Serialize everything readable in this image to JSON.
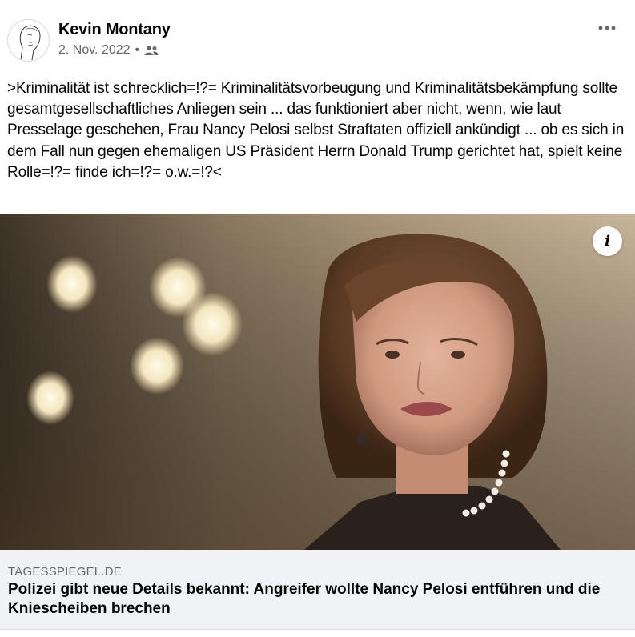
{
  "post": {
    "author": "Kevin Montany",
    "date": "2. Nov. 2022",
    "separator": "•",
    "audience_icon": "friends-icon",
    "more_icon": "more-options-icon",
    "text": ">Kriminalität ist schrecklich=!?= Kriminalitätsvorbeugung und Kriminalitätsbekämpfung sollte gesamtgesellschaftliches Anliegen sein ... das funktioniert aber nicht, wenn, wie laut Presselage geschehen, Frau Nancy Pelosi selbst Straftaten offiziell ankündigt ... ob es sich in dem Fall nun gegen ehemaligen US Präsident Herrn Donald Trump gerichtet hat, spielt keine Rolle=!?= finde ich=!?= o.w.=!?<"
  },
  "link": {
    "info_label": "i",
    "domain": "TAGESSPIEGEL.DE",
    "headline": "Polizei gibt neue Details bekannt: Angreifer wollte Nancy Pelosi entführen und die Kniescheiben brechen"
  },
  "colors": {
    "text": "#050505",
    "secondary": "#65676b",
    "card_bg": "#f0f2f5"
  }
}
